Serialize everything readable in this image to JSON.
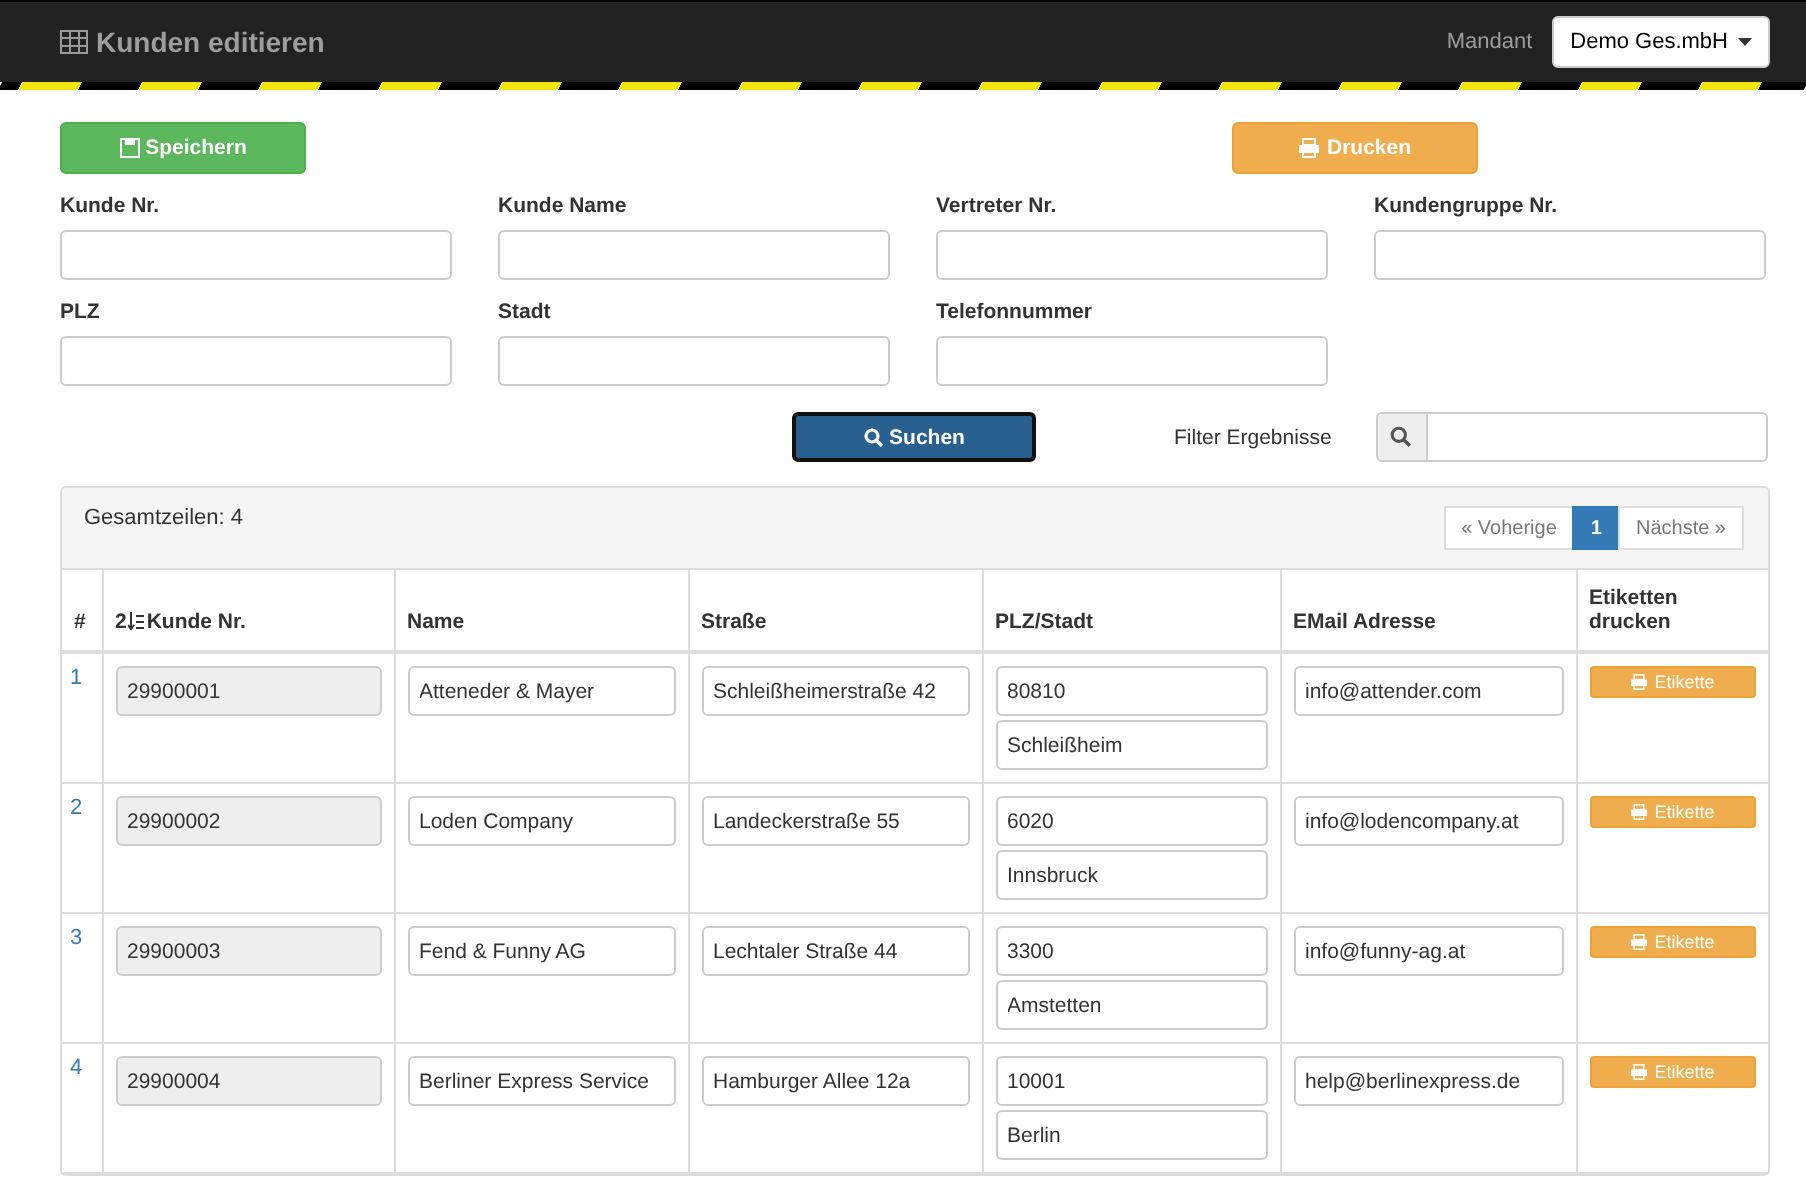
{
  "header": {
    "title": "Kunden editieren",
    "tenant_label": "Mandant",
    "tenant_value": "Demo Ges.mbH"
  },
  "actions": {
    "save": "Speichern",
    "print": "Drucken"
  },
  "fields": [
    {
      "label": "Kunde Nr."
    },
    {
      "label": "Kunde Name"
    },
    {
      "label": "Vertreter Nr."
    },
    {
      "label": "Kundengruppe Nr."
    },
    {
      "label": "PLZ"
    },
    {
      "label": "Stadt"
    },
    {
      "label": "Telefonnummer"
    }
  ],
  "search_button": "Suchen",
  "filter_label": "Filter Ergebnisse",
  "table": {
    "total": "Gesamtzeilen: 4",
    "pagination": [
      {
        "label": "« Voherige",
        "selected": false
      },
      {
        "label": "1",
        "selected": true
      },
      {
        "label": "Nächste »",
        "selected": false
      }
    ],
    "sort_mark": "2",
    "columns": [
      "#",
      "Kunde Nr.",
      "Name",
      "Straße",
      "PLZ/Stadt",
      "EMail Adresse",
      "Etiketten drucken"
    ],
    "rows": [
      {
        "index": "1",
        "number": "29900001",
        "name": "Atteneder & Mayer",
        "street": "Schleißheimerstraße 42",
        "zip": "80810",
        "city": "Schleißheim",
        "email": "info@attender.com",
        "print_label": "Etikette"
      },
      {
        "index": "2",
        "number": "29900002",
        "name": "Loden Company",
        "street": "Landeckerstraße 55",
        "zip": "6020",
        "city": "Innsbruck",
        "email": "info@lodencompany.at",
        "print_label": "Etikette"
      },
      {
        "index": "3",
        "number": "29900003",
        "name": "Fend & Funny AG",
        "street": "Lechtaler Straße 44",
        "zip": "3300",
        "city": "Amstetten",
        "email": "info@funny-ag.at",
        "print_label": "Etikette"
      },
      {
        "index": "4",
        "number": "29900004",
        "name": "Berliner Express Service",
        "street": "Hamburger Allee 12a",
        "zip": "10001",
        "city": "Berlin",
        "email": "help@berlinexpress.de",
        "print_label": "Etikette"
      }
    ]
  }
}
